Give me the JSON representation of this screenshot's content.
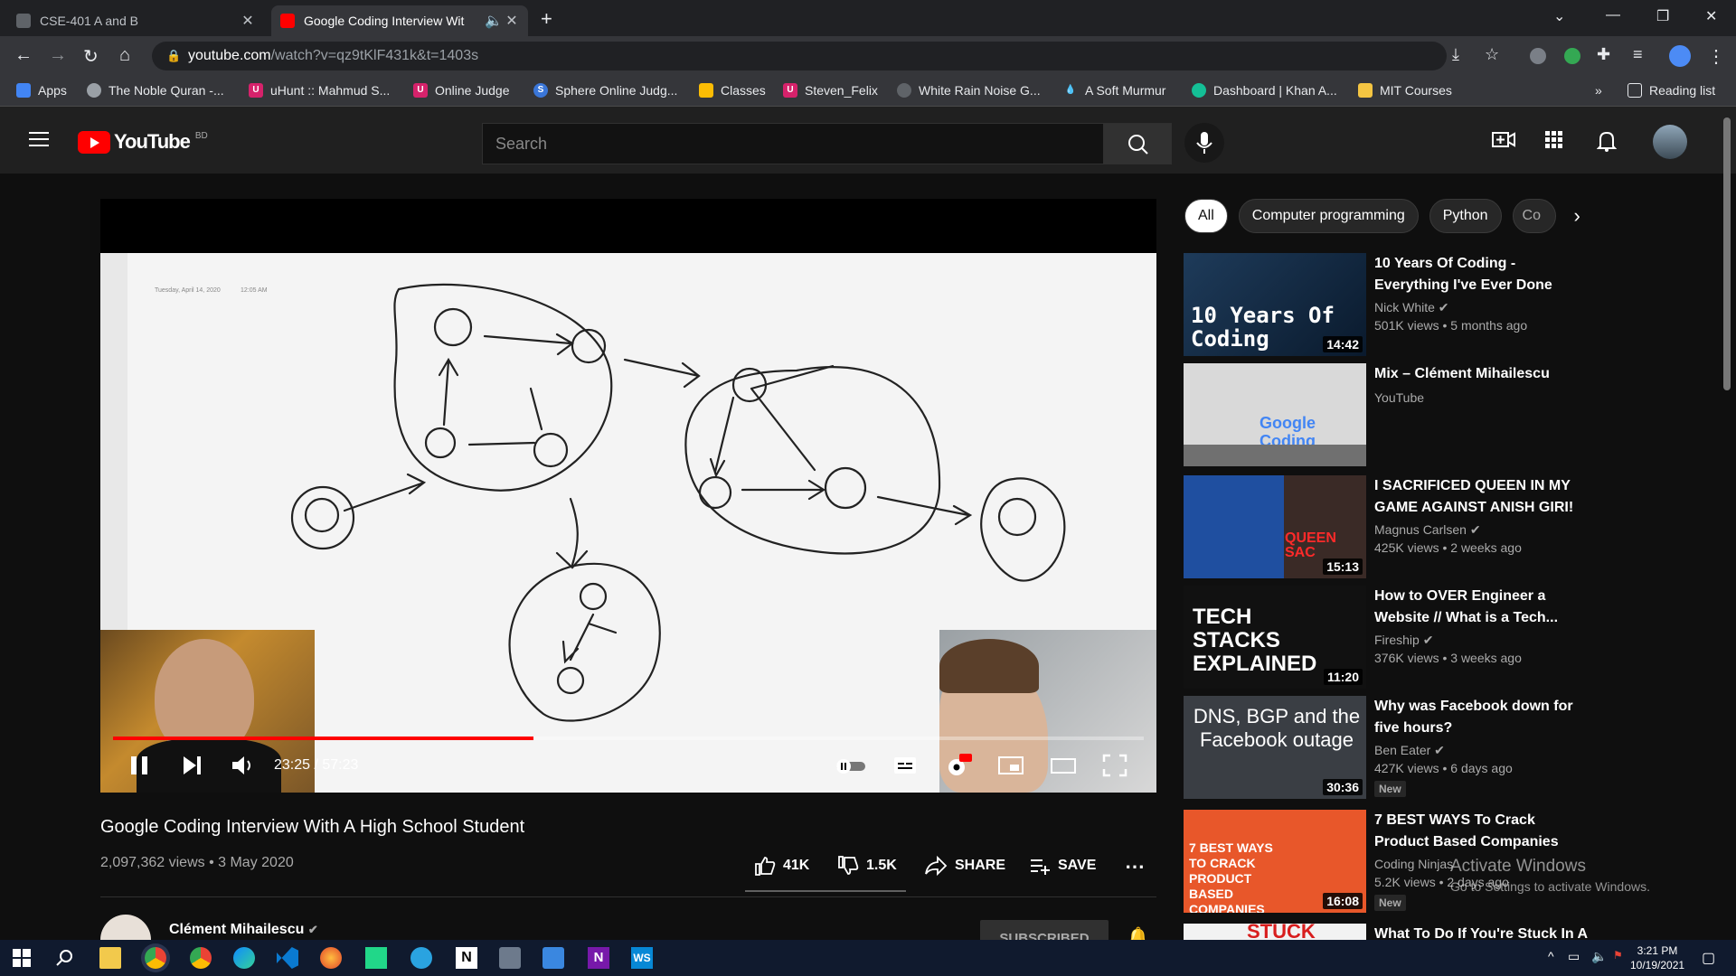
{
  "browser": {
    "tabs": [
      {
        "title": "CSE-401 A and B"
      },
      {
        "title": "Google Coding Interview Wit"
      }
    ],
    "url_host": "youtube.com",
    "url_path": "/watch?v=qz9tKlF431k&t=1403s",
    "bookmarks": [
      "Apps",
      "The Noble Quran -...",
      "uHunt :: Mahmud S...",
      "Online Judge",
      "Sphere Online Judg...",
      "Classes",
      "Steven_Felix",
      "White Rain Noise G...",
      "A Soft Murmur",
      "Dashboard | Khan A...",
      "MIT Courses"
    ],
    "reading_list": "Reading list"
  },
  "youtube": {
    "logo_text": "YouTube",
    "country": "BD",
    "search_placeholder": "Search"
  },
  "video": {
    "whiteboard_date": "Tuesday, April 14, 2020",
    "whiteboard_time": "12:05 AM",
    "time": "23:25 / 57:23",
    "progress_fraction": 0.408,
    "title": "Google Coding Interview With A High School Student",
    "meta": "2,097,362 views • 3 May 2020",
    "likes": "41K",
    "dislikes": "1.5K",
    "share": "SHARE",
    "save": "SAVE",
    "channel": "Clément Mihailescu",
    "subscribe": "SUBSCRIBED"
  },
  "chips": [
    "All",
    "Computer programming",
    "Python",
    "Co"
  ],
  "recommendations": [
    {
      "title": "10 Years Of Coding - Everything I've Ever Done",
      "channel": "Nick White",
      "meta": "501K views • 5 months ago",
      "duration": "14:42",
      "thumb_text": "10 Years Of Coding"
    },
    {
      "title": "Mix – Clément Mihailescu",
      "channel": "YouTube",
      "meta": "",
      "duration": "",
      "thumb_text": "Google Coding Interview"
    },
    {
      "title": "I SACRIFICED QUEEN IN MY GAME AGAINST ANISH GIRI!",
      "channel": "Magnus Carlsen",
      "meta": "425K views • 2 weeks ago",
      "duration": "15:13",
      "thumb_text": "QUEEN SAC"
    },
    {
      "title": "How to OVER Engineer a Website // What is a Tech...",
      "channel": "Fireship",
      "meta": "376K views • 3 weeks ago",
      "duration": "11:20",
      "thumb_text": "TECH STACKS EXPLAINED"
    },
    {
      "title": "Why was Facebook down for five hours?",
      "channel": "Ben Eater",
      "meta": "427K views • 6 days ago",
      "duration": "30:36",
      "thumb_text": "DNS, BGP and the Facebook outage",
      "new": "New"
    },
    {
      "title": "7 BEST WAYS To Crack Product Based Companies",
      "channel": "Coding Ninjas",
      "meta": "5.2K views • 2 days ago",
      "duration": "16:08",
      "thumb_text": "7 BEST WAYS TO CRACK PRODUCT BASED COMPANIES",
      "new": "New"
    },
    {
      "title": "What To Do If You're Stuck In A",
      "channel": "",
      "meta": "",
      "duration": "",
      "thumb_text": "STUCK"
    }
  ],
  "windows": {
    "activate_title": "Activate Windows",
    "activate_sub": "Go to Settings to activate Windows.",
    "time": "3:21 PM",
    "date": "10/19/2021"
  },
  "colors": {
    "accent": "#ff0000",
    "background": "#0f0f0f",
    "header": "#202020"
  }
}
